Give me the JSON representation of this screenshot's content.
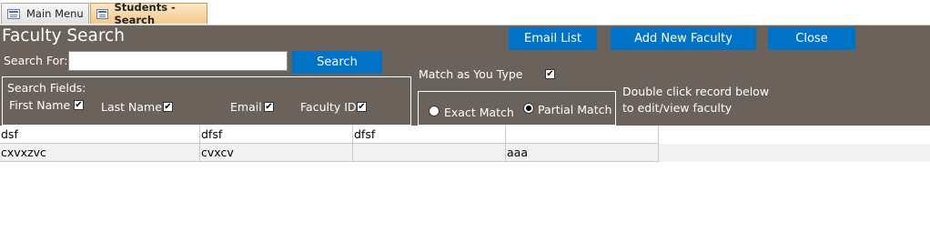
{
  "tabs": [
    {
      "label": "Main Menu",
      "active": false
    },
    {
      "label": "Students - Search",
      "active": true
    }
  ],
  "form": {
    "title": "Faculty Search",
    "search_for_label": "Search For:",
    "search_value": "",
    "search_button": "Search",
    "email_list_button": "Email List",
    "add_faculty_button": "Add New Faculty",
    "close_button": "Close",
    "match_as_you_type_label": "Match as You Type",
    "match_as_you_type_checked": true,
    "search_fields": {
      "label": "Search Fields:",
      "first_name": {
        "label": "First Name",
        "checked": true
      },
      "last_name": {
        "label": "Last Name",
        "checked": true
      },
      "email": {
        "label": "Email",
        "checked": true
      },
      "faculty_id": {
        "label": "Faculty ID",
        "checked": true
      }
    },
    "match_mode": {
      "exact": {
        "label": "Exact Match",
        "selected": false
      },
      "partial": {
        "label": "Partial Match",
        "selected": true
      }
    },
    "hint_line1": "Double click record below",
    "hint_line2": "to edit/view faculty"
  },
  "results": {
    "rows": [
      [
        "dsf",
        "dfsf",
        "dfsf",
        ""
      ],
      [
        "cxvxzvc",
        "cvxcv",
        "",
        "aaa"
      ]
    ]
  },
  "colors": {
    "form_bg": "#6b635b",
    "button_bg": "#0073c6",
    "active_tab": "#f6c98d"
  }
}
